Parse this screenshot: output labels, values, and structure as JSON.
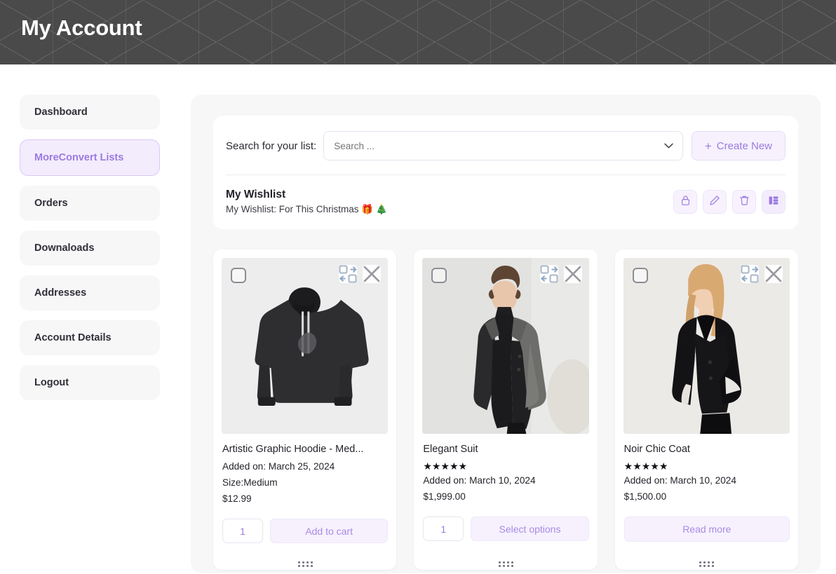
{
  "header": {
    "title": "My Account"
  },
  "sidebar": {
    "items": [
      {
        "label": "Dashboard",
        "active": false
      },
      {
        "label": "MoreConvert Lists",
        "active": true
      },
      {
        "label": "Orders",
        "active": false
      },
      {
        "label": "Downaloads",
        "active": false
      },
      {
        "label": "Addresses",
        "active": false
      },
      {
        "label": "Account Details",
        "active": false
      },
      {
        "label": "Logout",
        "active": false
      }
    ]
  },
  "list_panel": {
    "search_label": "Search for your list:",
    "search_placeholder": "Search ...",
    "search_value": "",
    "create_new_label": "Create New",
    "plus": "+",
    "wishlist_name": "My Wishlist",
    "wishlist_description": "My Wishlist: For This Christmas 🎁 🎄",
    "actions": [
      {
        "name": "lock-icon",
        "title": "Privacy"
      },
      {
        "name": "pencil-icon",
        "title": "Edit"
      },
      {
        "name": "trash-icon",
        "title": "Delete"
      },
      {
        "name": "grid-view-icon",
        "title": "Grid view"
      }
    ]
  },
  "products": [
    {
      "title": "Artistic Graphic Hoodie - Med...",
      "rating": 0,
      "stars": "",
      "added_on": "Added on: March 25, 2024",
      "variation": "Size:Medium",
      "price": "$12.99",
      "qty": "1",
      "action_label": "Add to cart",
      "has_qty": true
    },
    {
      "title": "Elegant Suit",
      "rating": 5,
      "stars": "★★★★★",
      "added_on": "Added on: March 10, 2024",
      "variation": "",
      "price": "$1,999.00",
      "qty": "1",
      "action_label": "Select options",
      "has_qty": true
    },
    {
      "title": "Noir Chic Coat",
      "rating": 5,
      "stars": "★★★★★",
      "added_on": "Added on: March 10, 2024",
      "variation": "",
      "price": "$1,500.00",
      "qty": "",
      "action_label": "Read more",
      "has_qty": false
    }
  ],
  "colors": {
    "accent": "#9b7ae0",
    "accent_soft": "#f6f1fd",
    "header_bg": "#4a4a4a",
    "panel_bg": "#f7f7f8",
    "text": "#24242c"
  }
}
